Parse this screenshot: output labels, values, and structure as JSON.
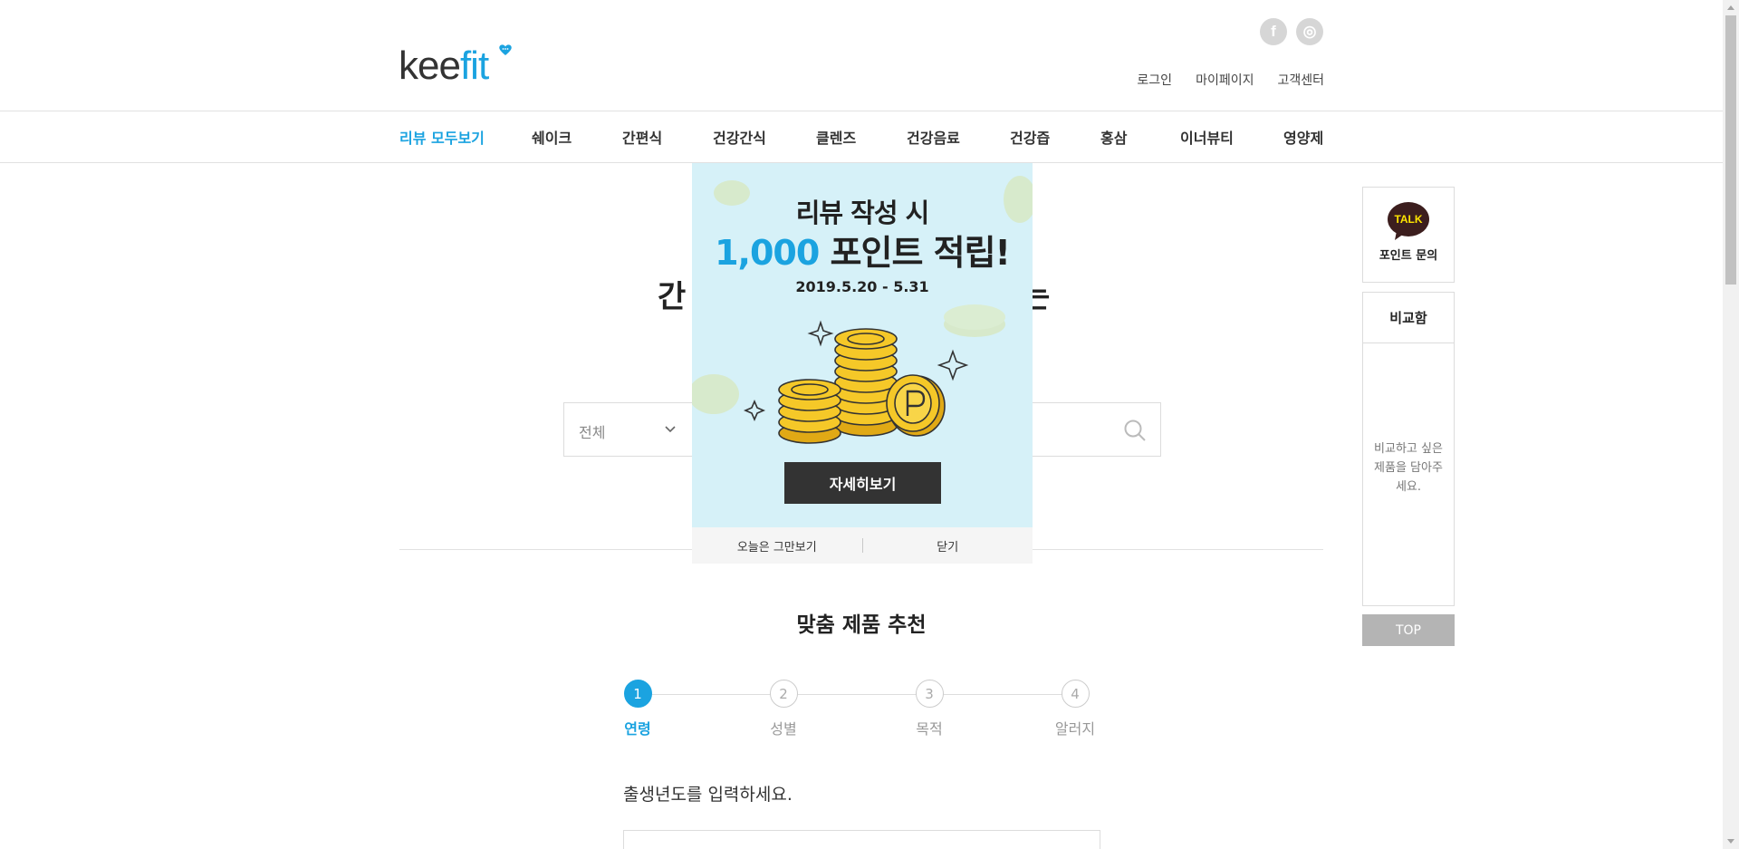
{
  "header": {
    "logo": {
      "part1": "kee",
      "part2": "fit"
    },
    "social": {
      "facebook": "f",
      "instagram": "◎"
    },
    "util_links": [
      "로그인",
      "마이페이지",
      "고객센터"
    ]
  },
  "nav": {
    "items": [
      "리뷰 모두보기",
      "쉐이크",
      "간편식",
      "건강간식",
      "클렌즈",
      "건강음료",
      "건강즙",
      "홍삼",
      "이너뷰티",
      "영양제"
    ],
    "active_index": 0
  },
  "hero": {
    "title_left": "간",
    "title_right": "는"
  },
  "search": {
    "category": "전체"
  },
  "recommend": {
    "title": "맞춤 제품 추천",
    "steps": [
      {
        "num": "1",
        "label": "연령"
      },
      {
        "num": "2",
        "label": "성별"
      },
      {
        "num": "3",
        "label": "목적"
      },
      {
        "num": "4",
        "label": "알러지"
      }
    ],
    "active_step": 0,
    "birth_label": "출생년도를 입력하세요."
  },
  "sidebar": {
    "talk_badge": "TALK",
    "talk_label": "포인트 문의",
    "compare_title": "비교함",
    "compare_empty": "비교하고 싶은 제품을 담아주세요.",
    "top_label": "TOP"
  },
  "popup": {
    "line1": "리뷰 작성 시",
    "line2_number": "1,000",
    "line2_rest": " 포인트 적립!",
    "date": "2019.5.20 - 5.31",
    "detail_button": "자세히보기",
    "dismiss_today": "오늘은 그만보기",
    "close": "닫기"
  },
  "colors": {
    "accent": "#1ba3e0",
    "popup_bg": "#d6f1f8",
    "coin": "#f5c828",
    "talk": "#3c1e1e",
    "talk_text": "#fee500"
  }
}
